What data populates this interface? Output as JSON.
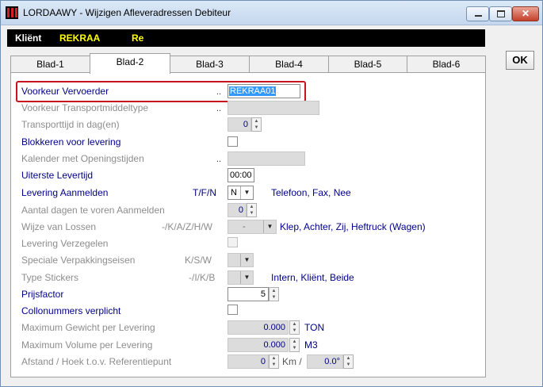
{
  "window": {
    "title": "LORDAAWY - Wijzigen Afleveradressen Debiteur",
    "close_glyph": "✕"
  },
  "client": {
    "label": "Kliënt",
    "value": "REKRAA",
    "value_extra": "Re"
  },
  "tabs": [
    "Blad-1",
    "Blad-2",
    "Blad-3",
    "Blad-4",
    "Blad-5",
    "Blad-6"
  ],
  "active_tab": "Blad-2",
  "ok_label": "OK",
  "form": {
    "voorkeur_vervoerder": {
      "label": "Voorkeur Vervoerder",
      "dots": "..",
      "value": "REKRAA01"
    },
    "voorkeur_transportmiddeltype": {
      "label": "Voorkeur Transportmiddeltype",
      "dots": "..",
      "value": ""
    },
    "transporttijd": {
      "label": "Transporttijd in dag(en)",
      "value": "0"
    },
    "blokkeren": {
      "label": "Blokkeren voor levering",
      "checked": false
    },
    "kalender": {
      "label": "Kalender met Openingstijden",
      "dots": "..",
      "value": ""
    },
    "uiterste_levertijd": {
      "label": "Uiterste Levertijd",
      "value": "00:00"
    },
    "levering_aanmelden": {
      "label": "Levering Aanmelden",
      "codes": "T/F/N",
      "value": "N",
      "description": "Telefoon, Fax, Nee"
    },
    "aantal_dagen": {
      "label": "Aantal dagen te voren Aanmelden",
      "value": "0"
    },
    "wijze_van_lossen": {
      "label": "Wijze van Lossen",
      "codes": "-/K/A/Z/H/W",
      "value": "-",
      "description": "Klep, Achter, Zij, Heftruck (Wagen)"
    },
    "levering_verzegelen": {
      "label": "Levering Verzegelen",
      "checked": false
    },
    "speciale_verpakking": {
      "label": "Speciale Verpakkingseisen",
      "codes": "K/S/W",
      "value": ""
    },
    "type_stickers": {
      "label": "Type Stickers",
      "codes": "-/I/K/B",
      "value": "",
      "description": "Intern, Kliënt, Beide"
    },
    "prijsfactor": {
      "label": "Prijsfactor",
      "value": "5"
    },
    "collonummers": {
      "label": "Collonummers verplicht",
      "checked": false
    },
    "max_gewicht": {
      "label": "Maximum Gewicht per Levering",
      "value": "0.000",
      "unit": "TON"
    },
    "max_volume": {
      "label": "Maximum Volume  per Levering",
      "value": "0.000",
      "unit": "M3"
    },
    "afstand": {
      "label": "Afstand / Hoek t.o.v. Referentiepunt",
      "value": "0",
      "unit": "Km /",
      "angle": "0.0°"
    }
  },
  "icons": {
    "spin_up": "▲",
    "spin_down": "▼",
    "dropdown": "▼"
  },
  "colors": {
    "enabled_label": "#00008b",
    "disabled_label": "#8d8d8d",
    "highlight": "#c8141e",
    "client_value": "#ffff00"
  }
}
